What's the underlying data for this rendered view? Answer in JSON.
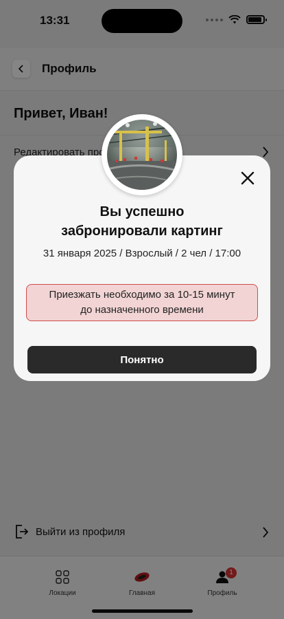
{
  "status_bar": {
    "time": "13:31"
  },
  "header": {
    "title": "Профиль"
  },
  "profile": {
    "greeting": "Привет, Иван!",
    "edit_label": "Редактировать профиль",
    "logout_label": "Выйти из профиля"
  },
  "modal": {
    "title_line1": "Вы успешно",
    "title_line2": "забронировали картинг",
    "details": "31 января 2025 / Взрослый / 2 чел / 17:00",
    "notice_line1": "Приезжать необходимо за 10-15 минут",
    "notice_line2": "до назначенного времени",
    "ok_label": "Понятно"
  },
  "tabbar": {
    "items": [
      {
        "label": "Локации",
        "icon": "grid-icon"
      },
      {
        "label": "Главная",
        "icon": "kart-logo-icon"
      },
      {
        "label": "Профиль",
        "icon": "user-icon",
        "badge": "1"
      }
    ]
  },
  "colors": {
    "accent": "#2a2a2a",
    "notice_bg": "#f2d4d4",
    "notice_border": "#d04a4a",
    "badge": "#d33333"
  }
}
